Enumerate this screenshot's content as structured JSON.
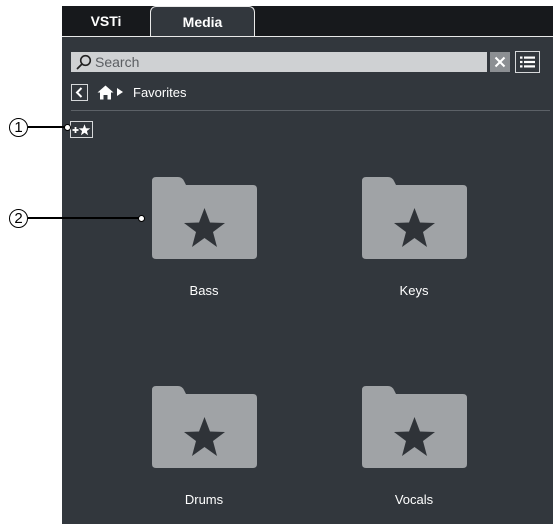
{
  "tabs": [
    {
      "label": "VSTi",
      "active": false
    },
    {
      "label": "Media",
      "active": true
    }
  ],
  "search": {
    "placeholder": "Search",
    "value": ""
  },
  "breadcrumb": {
    "current": "Favorites"
  },
  "folders": [
    {
      "label": "Bass"
    },
    {
      "label": "Keys"
    },
    {
      "label": "Drums"
    },
    {
      "label": "Vocals"
    }
  ],
  "callouts": [
    "1",
    "2"
  ],
  "colors": {
    "panel": "#32373d",
    "tabbar": "#17191c",
    "folder": "#a0a3a6",
    "star": "#2f3338",
    "search_bg": "#cfd1d3"
  },
  "icons": [
    "search-icon",
    "clear-icon",
    "list-view-icon",
    "back-icon",
    "home-icon",
    "add-favorite-icon",
    "star-icon",
    "folder-icon"
  ]
}
